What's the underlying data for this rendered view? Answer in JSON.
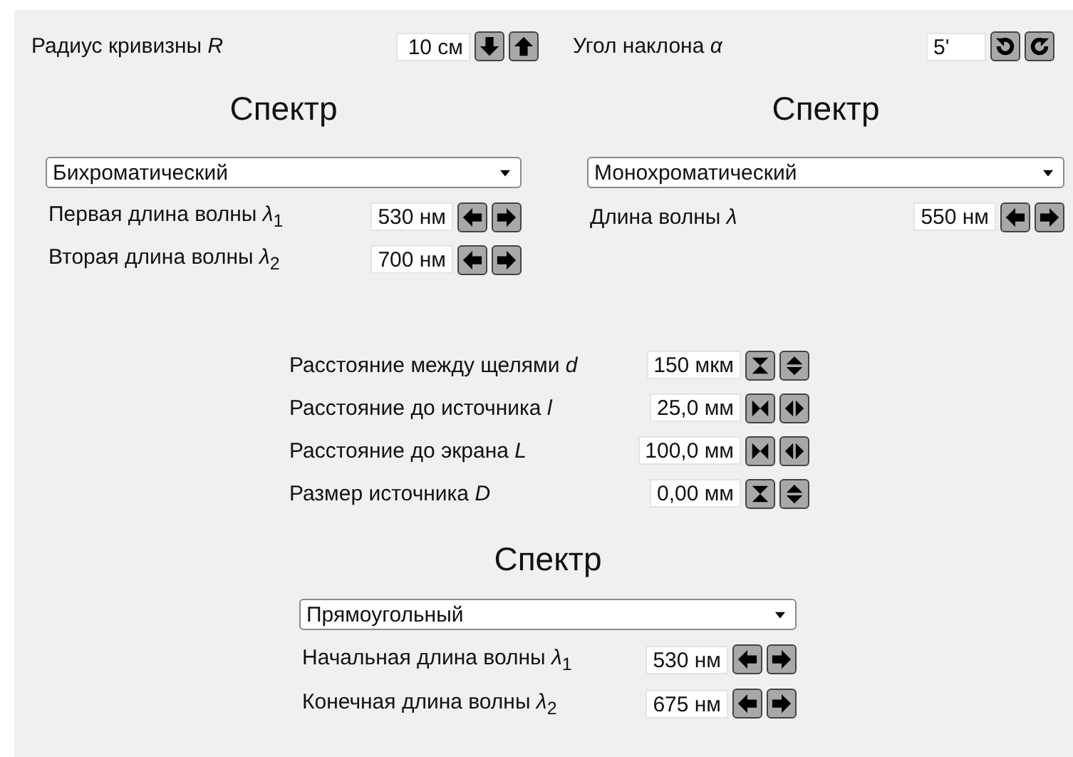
{
  "top": [
    {
      "label": "Радиус кривизны *R*",
      "value": "10 см",
      "buttons": [
        {
          "kind": "arrow-down"
        },
        {
          "kind": "arrow-up"
        }
      ]
    },
    {
      "label": "Угол наклона *α*",
      "value": "5'",
      "buttons": [
        {
          "kind": "rotate-ccw"
        },
        {
          "kind": "rotate-cw"
        }
      ]
    }
  ],
  "spectra": [
    {
      "title": "Спектр",
      "select": "Бихроматический",
      "rows": [
        {
          "label": "Первая длина волны *λ*$_{1}$",
          "value": "530 нм",
          "buttons": [
            {
              "kind": "arrow-left"
            },
            {
              "kind": "arrow-right"
            }
          ]
        },
        {
          "label": "Вторая длина волны *λ*$_{2}$",
          "value": "700 нм",
          "buttons": [
            {
              "kind": "arrow-left"
            },
            {
              "kind": "arrow-right"
            }
          ]
        }
      ]
    },
    {
      "title": "Спектр",
      "select": "Монохроматический",
      "rows": [
        {
          "label": "Длина волны *λ*",
          "value": "550 нм",
          "buttons": [
            {
              "kind": "arrow-left"
            },
            {
              "kind": "arrow-right"
            }
          ]
        }
      ]
    }
  ],
  "geometry": [
    {
      "label": "Расстояние между щелями *d*",
      "value": "150 мкм",
      "buttons": [
        {
          "kind": "converge-v"
        },
        {
          "kind": "diverge-v"
        }
      ]
    },
    {
      "label": "Расстояние до источника *l*",
      "value": "25,0 мм",
      "buttons": [
        {
          "kind": "converge-h"
        },
        {
          "kind": "diverge-h"
        }
      ]
    },
    {
      "label": "Расстояние до экрана *L*",
      "value": "100,0 мм",
      "buttons": [
        {
          "kind": "converge-h"
        },
        {
          "kind": "diverge-h"
        }
      ]
    },
    {
      "label": "Размер источника *D*",
      "value": "0,00 мм",
      "buttons": [
        {
          "kind": "converge-v"
        },
        {
          "kind": "diverge-v"
        }
      ]
    }
  ],
  "source_spectrum": {
    "title": "Спектр",
    "select": "Прямоугольный",
    "rows": [
      {
        "label": "Начальная длина волны *λ*$_{1}$",
        "value": "530 нм",
        "buttons": [
          {
            "kind": "arrow-left"
          },
          {
            "kind": "arrow-right"
          }
        ]
      },
      {
        "label": "Конечная длина волны *λ*$_{2}$",
        "value": "675 нм",
        "buttons": [
          {
            "kind": "arrow-left"
          },
          {
            "kind": "arrow-right"
          }
        ]
      }
    ]
  }
}
